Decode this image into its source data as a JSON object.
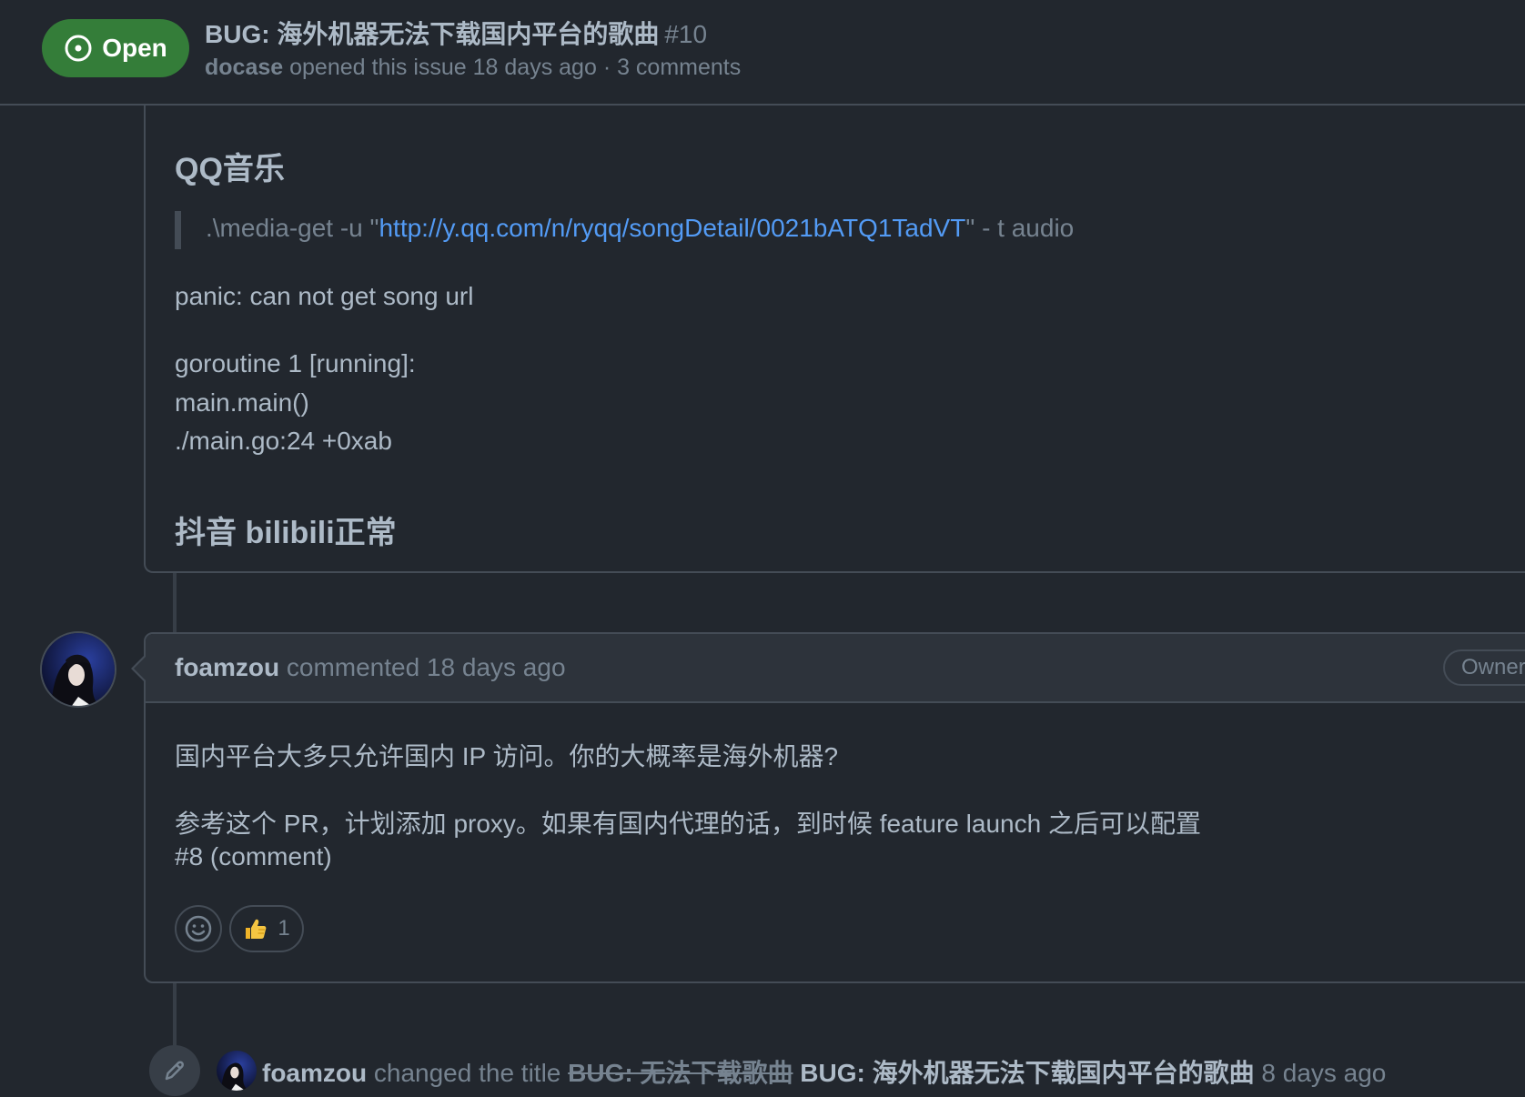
{
  "issue": {
    "state": "Open",
    "title": "BUG: 海外机器无法下载国内平台的歌曲",
    "number": "#10",
    "author": "docase",
    "meta": "opened this issue 18 days ago · 3 comments"
  },
  "body": {
    "heading_qq": "QQ音乐",
    "quote_prefix": ".\\media-get -u \"",
    "quote_link": "http://y.qq.com/n/ryqq/songDetail/0021bATQ1TadVT",
    "quote_suffix": "\" - t audio",
    "panic": "panic: can not get song url",
    "stack_1": "goroutine 1 [running]:",
    "stack_2": "main.main()",
    "stack_3": "./main.go:24 +0xab",
    "heading_ok": "抖音 bilibili正常"
  },
  "comment": {
    "author": "foamzou",
    "action": "commented 18 days ago",
    "role_badge": "Owner",
    "line_1": "国内平台大多只允许国内 IP 访问。你的大概率是海外机器?",
    "line_2": "参考这个 PR，计划添加 proxy。如果有国内代理的话，到时候 feature launch 之后可以配置",
    "link": "#8 (comment)",
    "reaction_count": "1",
    "reaction_icon": "thumbs-up"
  },
  "event": {
    "author": "foamzou",
    "action": "changed the title",
    "old_title": "BUG: 无法下载歌曲",
    "new_title": "BUG: 海外机器无法下载国内平台的歌曲",
    "time": "8 days ago",
    "icon": "pencil-icon"
  },
  "colors": {
    "background": "#22272e",
    "open_badge": "#347d39",
    "link": "#539bf5",
    "border": "#444c56"
  }
}
